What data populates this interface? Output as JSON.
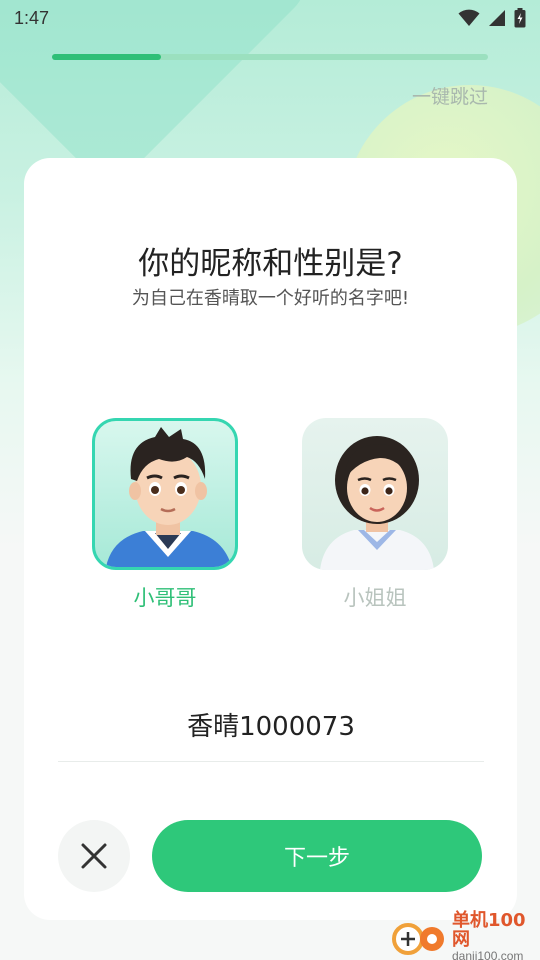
{
  "status_bar": {
    "time": "1:47"
  },
  "progress": {
    "fraction": 0.25
  },
  "header": {
    "skip_label": "一键跳过"
  },
  "card": {
    "title": "你的昵称和性别是?",
    "subtitle": "为自己在香晴取一个好听的名字吧!"
  },
  "gender_options": [
    {
      "label": "小哥哥",
      "selected": true
    },
    {
      "label": "小姐姐",
      "selected": false
    }
  ],
  "nickname": {
    "value": "香晴1000073"
  },
  "actions": {
    "next_label": "下一步"
  },
  "colors": {
    "accent": "#2ec87a",
    "selected_border": "#35d6b1"
  },
  "watermark": {
    "cn": "单机100网",
    "en": "danji100.com"
  }
}
